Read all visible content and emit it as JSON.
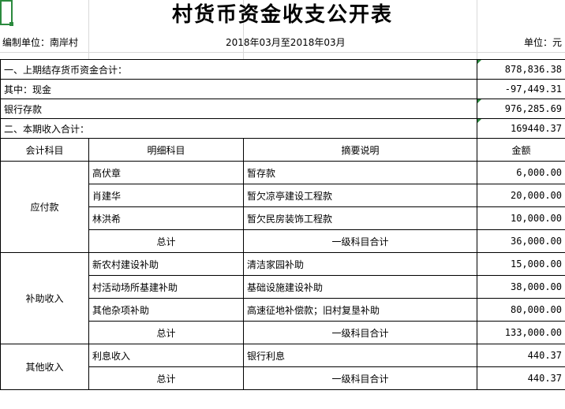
{
  "title": "村货币资金收支公开表",
  "meta": {
    "unit_label": "编制单位：南岸村",
    "period": "2018年03月至2018年03月",
    "currency": "单位：元"
  },
  "summary": {
    "prev_label": "一、上期结存货币资金合计：",
    "prev_value": "878,836.38",
    "cash_label": "其中：现金",
    "cash_value": "-97,449.31",
    "bank_label": "银行存款",
    "bank_value": "976,285.69",
    "income_label": "二、本期收入合计：",
    "income_value": "169440.37"
  },
  "headers": [
    "会计科目",
    "明细科目",
    "摘要说明",
    "金额"
  ],
  "groups": [
    {
      "account": "应付款",
      "rows": [
        {
          "detail": "高伏章",
          "desc": "暂存款",
          "amount": "6,000.00"
        },
        {
          "detail": "肖建华",
          "desc": "暂欠凉亭建设工程款",
          "amount": "20,000.00"
        },
        {
          "detail": "林洪希",
          "desc": "暂欠民房装饰工程款",
          "amount": "10,000.00"
        }
      ],
      "total_label": "总计",
      "total_desc": "一级科目合计",
      "total_amount": "36,000.00"
    },
    {
      "account": "补助收入",
      "rows": [
        {
          "detail": "新农村建设补助",
          "desc": "清洁家园补助",
          "amount": "15,000.00"
        },
        {
          "detail": "村活动场所基建补助",
          "desc": "基础设施建设补助",
          "amount": "38,000.00"
        },
        {
          "detail": "其他杂项补助",
          "desc": "高速征地补偿款；旧村复垦补助",
          "amount": "80,000.00"
        }
      ],
      "total_label": "总计",
      "total_desc": "一级科目合计",
      "total_amount": "133,000.00"
    },
    {
      "account": "其他收入",
      "rows": [
        {
          "detail": "利息收入",
          "desc": "银行利息",
          "amount": "440.37"
        }
      ],
      "total_label": "总计",
      "total_desc": "一级科目合计",
      "total_amount": "440.37"
    }
  ]
}
